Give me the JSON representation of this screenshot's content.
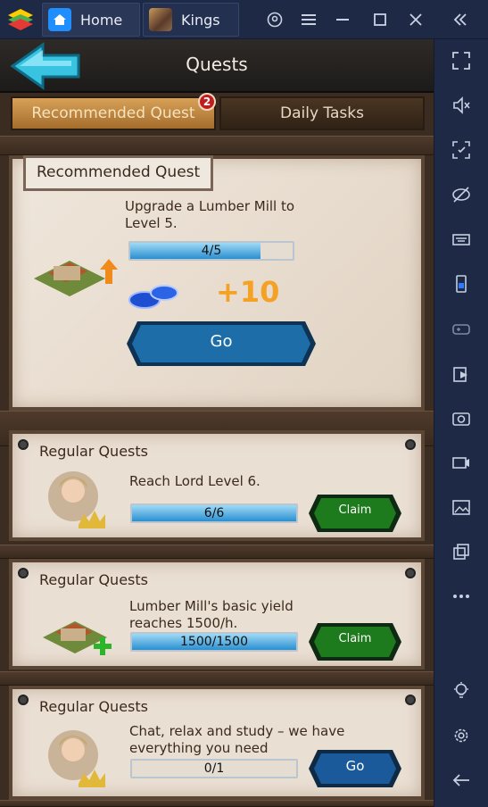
{
  "window": {
    "tabs": [
      {
        "label": "Home"
      },
      {
        "label": "Kings"
      }
    ]
  },
  "game": {
    "header_title": "Quests",
    "tabs": {
      "recommended": "Recommended Quest",
      "recommended_badge": "2",
      "daily": "Daily Tasks"
    },
    "recommended_card": {
      "label": "Recommended Quest",
      "description": "Upgrade a Lumber Mill to Level 5.",
      "progress_text": "4/5",
      "progress": 0.8,
      "reward_text": "+10",
      "button_label": "Go"
    },
    "regular_quests": [
      {
        "title": "Regular Quests",
        "description": "Reach Lord Level 6.",
        "progress_text": "6/6",
        "progress": 1.0,
        "button_label": "Claim",
        "button_color": "#1d7a1d"
      },
      {
        "title": "Regular Quests",
        "description": "Lumber Mill's basic yield reaches 1500/h.",
        "progress_text": "1500/1500",
        "progress": 1.0,
        "button_label": "Claim",
        "button_color": "#1d7a1d"
      },
      {
        "title": "Regular Quests",
        "description": "Chat, relax and study – we have everything you need",
        "progress_text": "0/1",
        "progress": 0.0,
        "button_label": "Go",
        "button_color": "#1a5a9a"
      }
    ]
  },
  "colors": {
    "accent_blue": "#1f8fff",
    "claim_green": "#1d7a1d",
    "go_blue": "#1a5a9a",
    "reward_orange": "#f4a124"
  }
}
